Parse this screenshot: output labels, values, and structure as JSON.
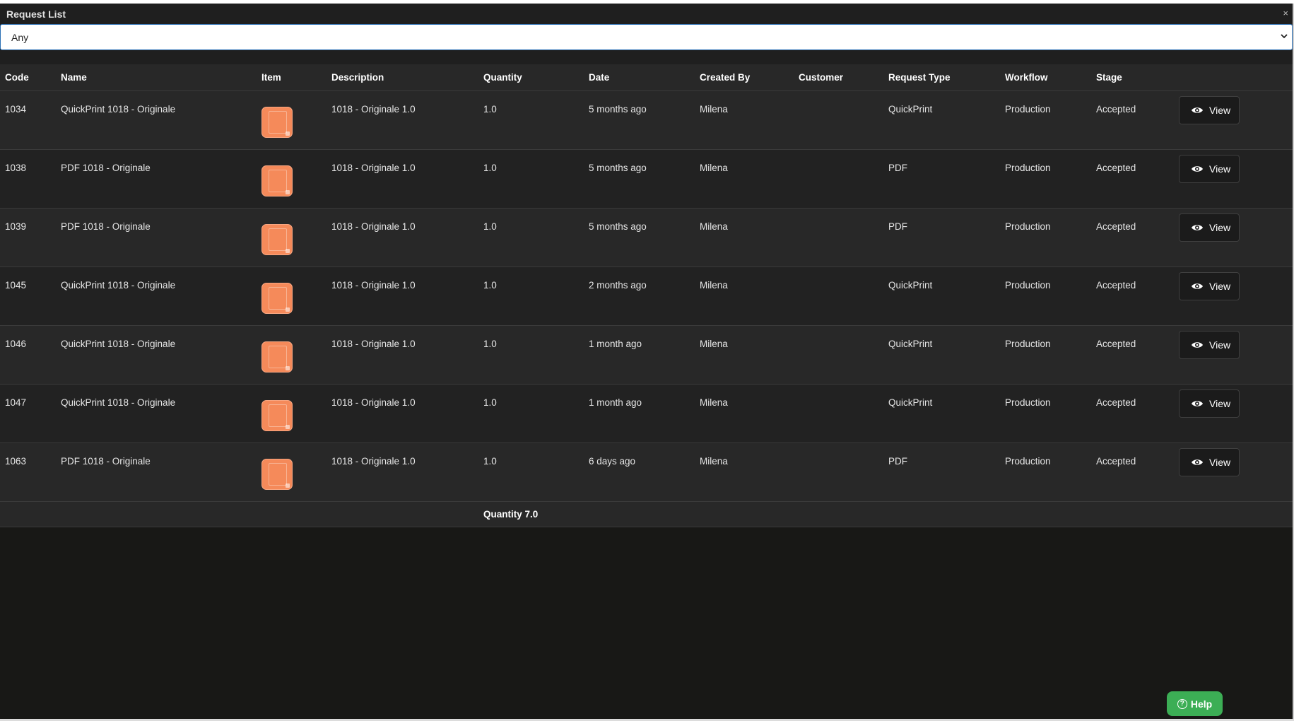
{
  "window": {
    "title": "Request List",
    "close_symbol": "×"
  },
  "filter": {
    "selected": "Any",
    "chevron_icon": "chevron-down-icon"
  },
  "table": {
    "headers": {
      "code": "Code",
      "name": "Name",
      "item": "Item",
      "description": "Description",
      "quantity": "Quantity",
      "date": "Date",
      "created_by": "Created By",
      "customer": "Customer",
      "request_type": "Request Type",
      "workflow": "Workflow",
      "stage": "Stage"
    },
    "rows": [
      {
        "code": "1034",
        "name": "QuickPrint 1018 - Originale",
        "description": "1018 - Originale 1.0",
        "quantity": "1.0",
        "date": "5 months ago",
        "created_by": "Milena",
        "customer": "",
        "request_type": "QuickPrint",
        "workflow": "Production",
        "stage": "Accepted",
        "view_label": "View"
      },
      {
        "code": "1038",
        "name": "PDF 1018 - Originale",
        "description": "1018 - Originale 1.0",
        "quantity": "1.0",
        "date": "5 months ago",
        "created_by": "Milena",
        "customer": "",
        "request_type": "PDF",
        "workflow": "Production",
        "stage": "Accepted",
        "view_label": "View"
      },
      {
        "code": "1039",
        "name": "PDF 1018 - Originale",
        "description": "1018 - Originale 1.0",
        "quantity": "1.0",
        "date": "5 months ago",
        "created_by": "Milena",
        "customer": "",
        "request_type": "PDF",
        "workflow": "Production",
        "stage": "Accepted",
        "view_label": "View"
      },
      {
        "code": "1045",
        "name": "QuickPrint 1018 - Originale",
        "description": "1018 - Originale 1.0",
        "quantity": "1.0",
        "date": "2 months ago",
        "created_by": "Milena",
        "customer": "",
        "request_type": "QuickPrint",
        "workflow": "Production",
        "stage": "Accepted",
        "view_label": "View"
      },
      {
        "code": "1046",
        "name": "QuickPrint 1018 - Originale",
        "description": "1018 - Originale 1.0",
        "quantity": "1.0",
        "date": "1 month ago",
        "created_by": "Milena",
        "customer": "",
        "request_type": "QuickPrint",
        "workflow": "Production",
        "stage": "Accepted",
        "view_label": "View"
      },
      {
        "code": "1047",
        "name": "QuickPrint 1018 - Originale",
        "description": "1018 - Originale 1.0",
        "quantity": "1.0",
        "date": "1 month ago",
        "created_by": "Milena",
        "customer": "",
        "request_type": "QuickPrint",
        "workflow": "Production",
        "stage": "Accepted",
        "view_label": "View"
      },
      {
        "code": "1063",
        "name": "PDF 1018 - Originale",
        "description": "1018 - Originale 1.0",
        "quantity": "1.0",
        "date": "6 days ago",
        "created_by": "Milena",
        "customer": "",
        "request_type": "PDF",
        "workflow": "Production",
        "stage": "Accepted",
        "view_label": "View"
      }
    ],
    "footer": {
      "quantity_total": "Quantity 7.0"
    }
  },
  "help": {
    "label": "Help",
    "icon": "question-circle-icon",
    "color": "#3cae55"
  },
  "colors": {
    "thumbnail": "#f58a5a",
    "filter_border": "#2a6fb5"
  }
}
